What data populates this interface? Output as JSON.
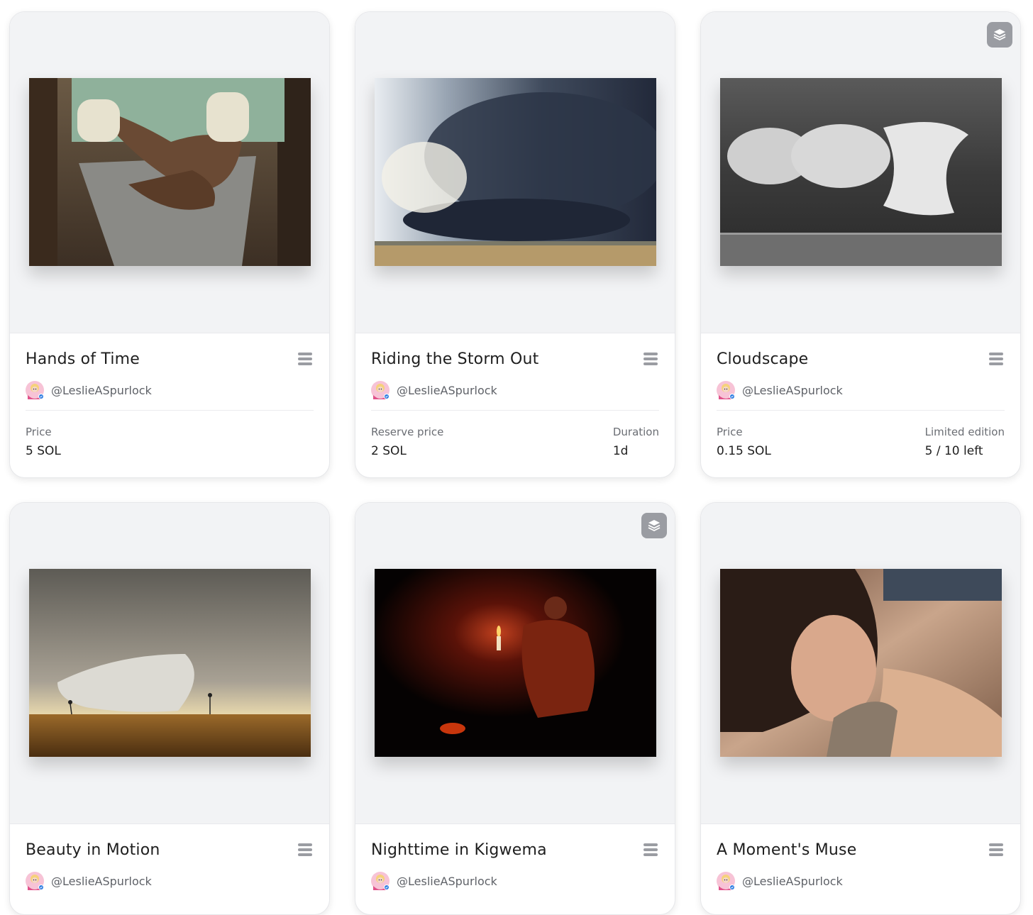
{
  "creator_handle": "@LeslieASpurlock",
  "cards": [
    {
      "title": "Hands of Time",
      "left_label": "Price",
      "left_value": "5 SOL",
      "right_label": "",
      "right_value": "",
      "edition_badge": false
    },
    {
      "title": "Riding the Storm Out",
      "left_label": "Reserve price",
      "left_value": "2 SOL",
      "right_label": "Duration",
      "right_value": "1d",
      "edition_badge": false
    },
    {
      "title": "Cloudscape",
      "left_label": "Price",
      "left_value": "0.15 SOL",
      "right_label": "Limited edition",
      "right_value": "5 / 10 left",
      "edition_badge": true
    },
    {
      "title": "Beauty in Motion",
      "edition_badge": false
    },
    {
      "title": "Nighttime in Kigwema",
      "edition_badge": true
    },
    {
      "title": "A Moment's Muse",
      "edition_badge": false
    }
  ],
  "icons": {
    "menu": "hamburger-menu-icon",
    "edition": "stack-layers-icon",
    "verified": "verified-check-icon"
  },
  "colors": {
    "art_bg": "#f2f3f5",
    "badge_bg": "#9a9ca2",
    "text_muted": "#6a6d73"
  }
}
